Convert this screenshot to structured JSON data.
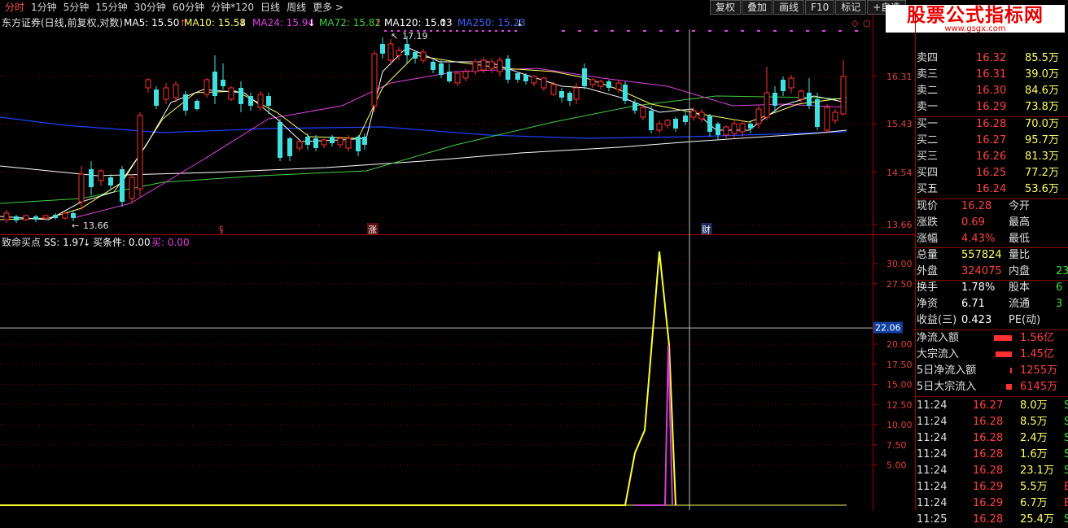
{
  "toolbar": {
    "tabs": [
      "分时",
      "1分钟",
      "5分钟",
      "15分钟",
      "30分钟",
      "60分钟",
      "分钟*120",
      "日线",
      "周线",
      "更多 >"
    ],
    "buttons": [
      "复权",
      "叠加",
      "画线",
      "F10",
      "标记",
      "+自选"
    ]
  },
  "logo": {
    "title": "股票公式指标网",
    "url": "www.gsgx.com"
  },
  "main_chart": {
    "stock_title": "东方证券(日线,前复权,对数)",
    "ma_labels": [
      {
        "text": "MA5: 15.50",
        "color": "#ffffff"
      },
      {
        "text": "MA10: 15.58",
        "color": "#ffff66"
      },
      {
        "text": "MA24: 15.94",
        "color": "#e040e0"
      },
      {
        "text": "MA72: 15.82",
        "color": "#40d040"
      },
      {
        "text": "MA120: 15.03",
        "color": "#ffffff"
      },
      {
        "text": "MA250: 15.23",
        "color": "#4060ff"
      }
    ],
    "y_ticks": [
      "16.31",
      "15.43",
      "14.54",
      "13.66"
    ],
    "high_label": "17.19",
    "low_label": "13.66",
    "markers": [
      "§",
      "涨",
      "财"
    ],
    "crosshair_icon": "◇"
  },
  "sub_chart": {
    "title": "致命买点",
    "labels": [
      {
        "text": "SS: 1.97",
        "color": "#ffffff"
      },
      {
        "text": "买条件: 0.00",
        "color": "#ffffff"
      },
      {
        "text": "买: 0.00",
        "color": "#e040e0"
      }
    ],
    "y_ticks": [
      "30.00",
      "27.50",
      "22.06",
      "20.00",
      "17.50",
      "15.00",
      "12.50",
      "10.00",
      "7.50",
      "5.00"
    ],
    "cursor_value": "22.06"
  },
  "chart_data": {
    "type": "line",
    "series": [
      {
        "name": "SS",
        "values": [
          0,
          0,
          6.5,
          9.3,
          31.5,
          19.9,
          0
        ]
      },
      {
        "name": "买",
        "values": [
          0,
          0,
          0,
          19.9,
          0
        ]
      }
    ],
    "ylim": [
      0,
      33
    ]
  },
  "quote": {
    "asks": [
      {
        "label": "卖四",
        "price": "16.32",
        "vol": "85.5万"
      },
      {
        "label": "卖三",
        "price": "16.31",
        "vol": "39.0万"
      },
      {
        "label": "卖二",
        "price": "16.30",
        "vol": "84.6万"
      },
      {
        "label": "卖一",
        "price": "16.29",
        "vol": "73.8万"
      }
    ],
    "bids": [
      {
        "label": "买一",
        "price": "16.28",
        "vol": "70.0万"
      },
      {
        "label": "买二",
        "price": "16.27",
        "vol": "95.7万"
      },
      {
        "label": "买三",
        "price": "16.26",
        "vol": "81.3万"
      },
      {
        "label": "买四",
        "price": "16.25",
        "vol": "77.2万"
      },
      {
        "label": "买五",
        "price": "16.24",
        "vol": "53.6万"
      }
    ],
    "stats": [
      {
        "l1": "现价",
        "v1": "16.28",
        "c1": "#ff4040",
        "l2": "今开",
        "v2": ""
      },
      {
        "l1": "涨跌",
        "v1": "0.69",
        "c1": "#ff4040",
        "l2": "最高",
        "v2": ""
      },
      {
        "l1": "涨幅",
        "v1": "4.43%",
        "c1": "#ff4040",
        "l2": "最低",
        "v2": ""
      },
      {
        "l1": "总量",
        "v1": "557824",
        "c1": "#ffff66",
        "l2": "量比",
        "v2": ""
      },
      {
        "l1": "外盘",
        "v1": "324075",
        "c1": "#ff4040",
        "l2": "内盘",
        "v2": "23"
      },
      {
        "l1": "换手",
        "v1": "1.78%",
        "c1": "#ffffff",
        "l2": "股本",
        "v2": "6"
      },
      {
        "l1": "净资",
        "v1": "6.71",
        "c1": "#ffffff",
        "l2": "流通",
        "v2": "3"
      },
      {
        "l1": "收益(三)",
        "v1": "0.423",
        "c1": "#ffffff",
        "l2": "PE(动)",
        "v2": ""
      }
    ],
    "flows": [
      {
        "label": "净流入额",
        "value": "1.56亿",
        "bar": 0.9
      },
      {
        "label": "大宗流入",
        "value": "1.45亿",
        "bar": 0.85
      },
      {
        "label": "5日净流入额",
        "value": "1255万",
        "bar": 0.05
      },
      {
        "label": "5日大宗流入",
        "value": "6145万",
        "bar": 0.3
      }
    ],
    "trades": [
      {
        "time": "11:24",
        "price": "16.27",
        "vol": "8.0万",
        "side": "S"
      },
      {
        "time": "11:24",
        "price": "16.28",
        "vol": "8.5万",
        "side": "S"
      },
      {
        "time": "11:24",
        "price": "16.28",
        "vol": "2.4万",
        "side": "S"
      },
      {
        "time": "11:24",
        "price": "16.28",
        "vol": "1.6万",
        "side": "S"
      },
      {
        "time": "11:24",
        "price": "16.28",
        "vol": "23.1万",
        "side": "S"
      },
      {
        "time": "11:24",
        "price": "16.29",
        "vol": "5.5万",
        "side": "B"
      },
      {
        "time": "11:24",
        "price": "16.29",
        "vol": "6.7万",
        "side": "B"
      },
      {
        "time": "11:25",
        "price": "16.28",
        "vol": "25.4万",
        "side": "S"
      }
    ]
  }
}
